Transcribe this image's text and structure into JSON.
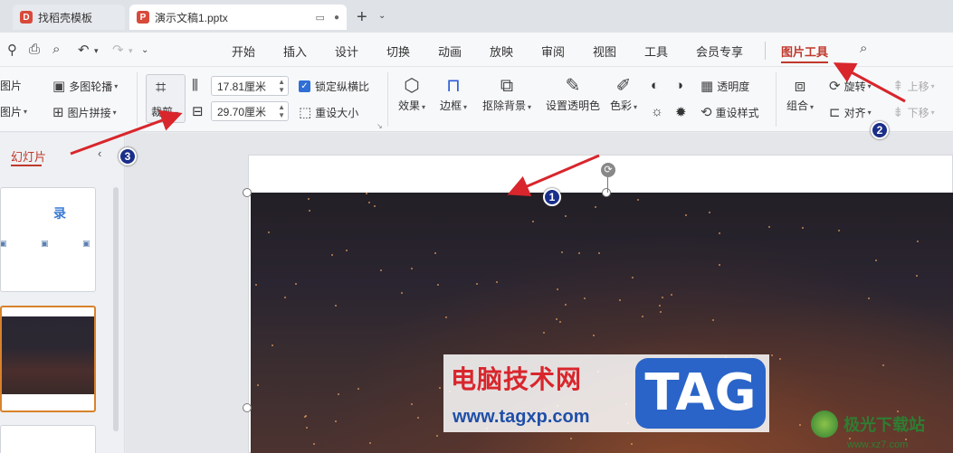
{
  "titlebar": {
    "tabs": [
      {
        "label": "找稻壳模板",
        "icon": "wps-docer-icon",
        "color": "#d84a3a"
      },
      {
        "label": "演示文稿1.pptx",
        "icon": "wps-presentation-icon",
        "color": "#d84a3a",
        "active": true
      }
    ],
    "new_tab": "+",
    "new_tab_menu": "⌄"
  },
  "menubar": {
    "items": [
      "开始",
      "插入",
      "设计",
      "切换",
      "动画",
      "放映",
      "审阅",
      "视图",
      "工具",
      "会员专享",
      "图片工具"
    ],
    "active": "图片工具",
    "accent": "#c0392b"
  },
  "ribbon": {
    "add_picture": "改图片",
    "multi_outline": "多图轮播",
    "add_picture2": "加图片",
    "picture_stitch": "图片拼接",
    "crop": "裁剪",
    "height_value": "17.81厘米",
    "width_value": "29.70厘米",
    "lock_ratio": "锁定纵横比",
    "reset_size": "重设大小",
    "effects": "效果",
    "border": "边框",
    "remove_bg": "抠除背景",
    "set_transparent": "设置透明色",
    "color": "色彩",
    "transparency": "透明度",
    "reset_style": "重设样式",
    "group": "组合",
    "rotate": "旋转",
    "align": "对齐",
    "move_up": "上移",
    "move_down": "下移"
  },
  "left_panel": {
    "tab_label": "幻灯片",
    "thumb1_title": "录"
  },
  "watermark": {
    "title": "电脑技术网",
    "url": "www.tagxp.com",
    "tag": "TAG",
    "site_name": "极光下载站",
    "site_url": "www.xz7.com"
  },
  "annotations": {
    "badge1": "1",
    "badge2": "2",
    "badge3": "3",
    "arrow_color": "#d8262c"
  }
}
